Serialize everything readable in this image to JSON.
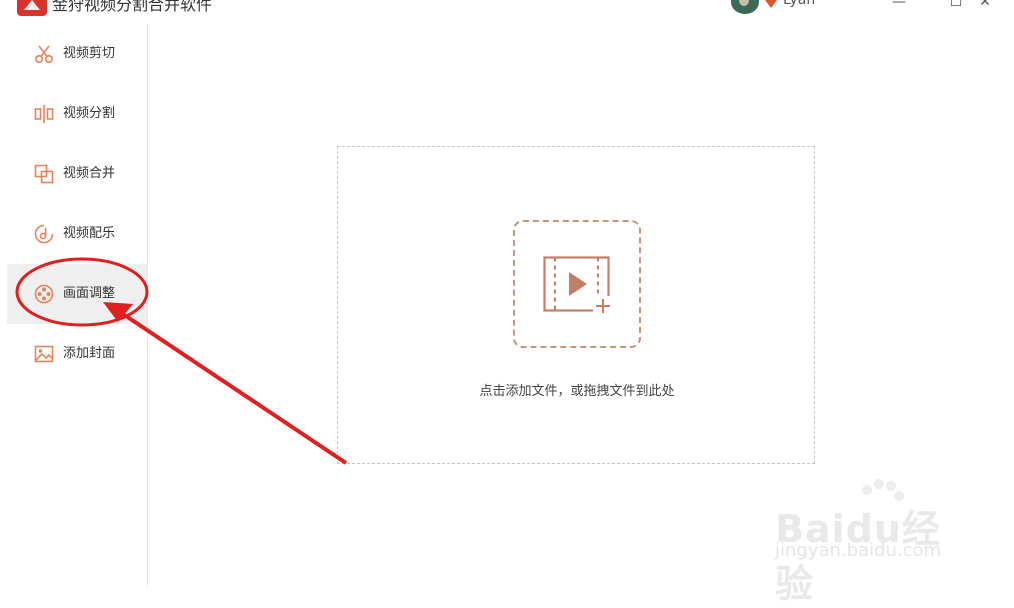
{
  "app": {
    "title": "金狩视频分割合并软件",
    "username": "Lyan",
    "brand_color": "#d6342b",
    "accent_color": "#e8825a"
  },
  "window_controls": {
    "minimize": "—",
    "maximize": "☐",
    "close": "✕"
  },
  "sidebar": {
    "items": [
      {
        "label": "视频剪切",
        "icon": "scissors-icon",
        "active": false
      },
      {
        "label": "视频分割",
        "icon": "split-icon",
        "active": false
      },
      {
        "label": "视频合并",
        "icon": "merge-icon",
        "active": false
      },
      {
        "label": "视频配乐",
        "icon": "music-icon",
        "active": false
      },
      {
        "label": "画面调整",
        "icon": "film-reel-icon",
        "active": true
      },
      {
        "label": "添加封面",
        "icon": "image-icon",
        "active": false
      }
    ]
  },
  "dropzone": {
    "hint": "点击添加文件，或拖拽文件到此处",
    "icon": "add-video-icon"
  },
  "watermark": {
    "brand": "Baidu经验",
    "url": "jingyan.baidu.com"
  }
}
